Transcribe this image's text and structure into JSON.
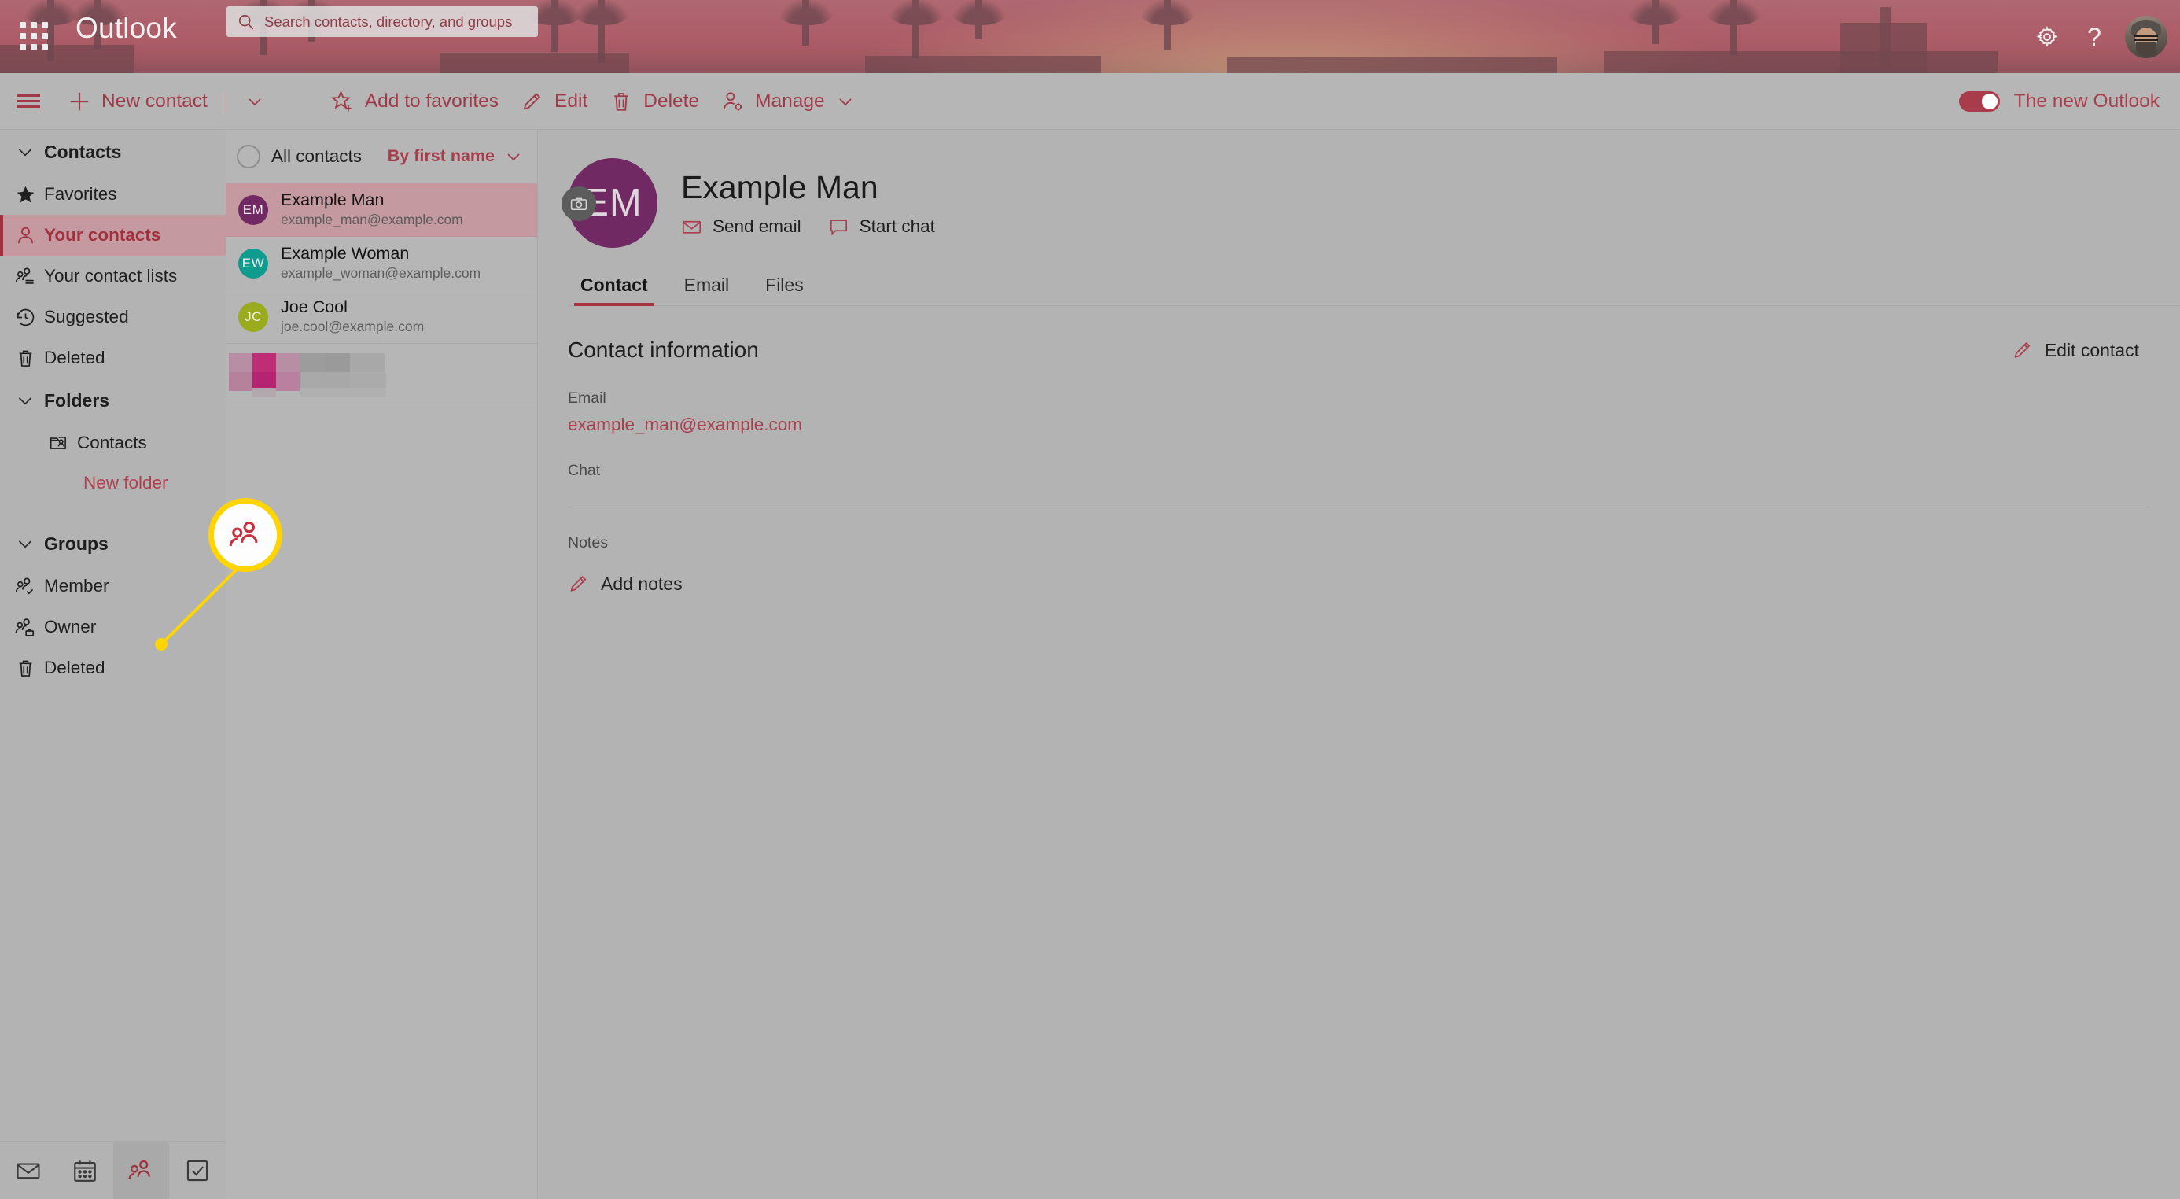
{
  "topbar": {
    "waffle_icon": "app-launcher-icon",
    "brand": "Outlook",
    "search": {
      "icon": "search-icon",
      "placeholder": "Search contacts, directory, and groups",
      "value": ""
    },
    "settings_icon": "gear-icon",
    "help_icon": "question-mark-icon",
    "avatar_icon": "user-avatar"
  },
  "commandbar": {
    "hamburger_icon": "hamburger-menu-icon",
    "new_contact": {
      "icon": "plus-icon",
      "label": "New contact",
      "chevron": "chevron-down-icon"
    },
    "add_to_favorites": {
      "icon": "star-add-icon",
      "label": "Add to favorites"
    },
    "edit": {
      "icon": "pencil-icon",
      "label": "Edit"
    },
    "delete": {
      "icon": "trash-icon",
      "label": "Delete"
    },
    "manage": {
      "icon": "person-settings-icon",
      "label": "Manage",
      "chevron": "chevron-down-icon"
    },
    "new_outlook_toggle": {
      "label": "The new Outlook",
      "state": "on"
    }
  },
  "sidebar": {
    "contacts_group": {
      "label": "Contacts",
      "chevron": "chevron-down-icon",
      "expanded": true
    },
    "items": [
      {
        "label": "Favorites",
        "icon": "star-filled-icon",
        "selected": false
      },
      {
        "label": "Your contacts",
        "icon": "person-icon",
        "selected": true
      },
      {
        "label": "Your contact lists",
        "icon": "contact-list-icon",
        "selected": false
      },
      {
        "label": "Suggested",
        "icon": "history-clock-icon",
        "selected": false
      },
      {
        "label": "Deleted",
        "icon": "trash-icon",
        "selected": false
      }
    ],
    "folders_group": {
      "label": "Folders",
      "chevron": "chevron-down-icon",
      "expanded": true
    },
    "folders": [
      {
        "label": "Contacts",
        "icon": "contacts-folder-icon"
      }
    ],
    "new_folder_link": "New folder",
    "groups_group": {
      "label": "Groups",
      "chevron": "chevron-down-icon",
      "expanded": true
    },
    "groups": [
      {
        "label": "Member",
        "icon": "people-check-icon"
      },
      {
        "label": "Owner",
        "icon": "people-briefcase-icon"
      },
      {
        "label": "Deleted",
        "icon": "trash-icon"
      }
    ]
  },
  "bottomnav": {
    "items": [
      {
        "name": "mail",
        "icon": "envelope-icon",
        "active": false
      },
      {
        "name": "calendar",
        "icon": "calendar-icon",
        "active": false
      },
      {
        "name": "people",
        "icon": "people-icon",
        "active": true
      },
      {
        "name": "tasks",
        "icon": "checkbox-icon",
        "active": false
      }
    ]
  },
  "list": {
    "select_all": {
      "icon": "selection-circle-icon",
      "checked": false
    },
    "all_contacts_label": "All contacts",
    "sort": {
      "label": "By first name",
      "chevron": "chevron-down-icon"
    },
    "contacts": [
      {
        "initials": "EM",
        "name": "Example Man",
        "email": "example_man@example.com",
        "color": "#702963",
        "selected": true
      },
      {
        "initials": "EW",
        "name": "Example Woman",
        "email": "example_woman@example.com",
        "color": "#0f9b8e",
        "selected": false
      },
      {
        "initials": "JC",
        "name": "Joe Cool",
        "email": "joe.cool@example.com",
        "color": "#9aab1e",
        "selected": false
      },
      {
        "redacted": true
      }
    ]
  },
  "detail": {
    "avatar": {
      "initials": "EM",
      "color": "#702963",
      "camera_icon": "camera-icon"
    },
    "name": "Example Man",
    "actions": [
      {
        "label": "Send email",
        "icon": "envelope-icon"
      },
      {
        "label": "Start chat",
        "icon": "chat-bubble-icon"
      }
    ],
    "tabs": [
      {
        "label": "Contact",
        "active": true
      },
      {
        "label": "Email",
        "active": false
      },
      {
        "label": "Files",
        "active": false
      }
    ],
    "contact_information_title": "Contact information",
    "edit_contact": {
      "label": "Edit contact",
      "icon": "pencil-icon"
    },
    "fields": [
      {
        "label": "Email",
        "value": "example_man@example.com",
        "is_link": true
      },
      {
        "label": "Chat",
        "value": "",
        "is_link": false
      }
    ],
    "notes_label": "Notes",
    "add_notes": {
      "label": "Add notes",
      "icon": "pencil-icon"
    }
  },
  "annotation": {
    "highlight_icon": "people-icon",
    "circle_color": "#ffd400",
    "line_color": "#ffd400"
  },
  "colors": {
    "accent": "#a8404e",
    "selection": "#c49aa0",
    "page_bg": "#b3b3b3",
    "highlight": "#ffd400"
  }
}
